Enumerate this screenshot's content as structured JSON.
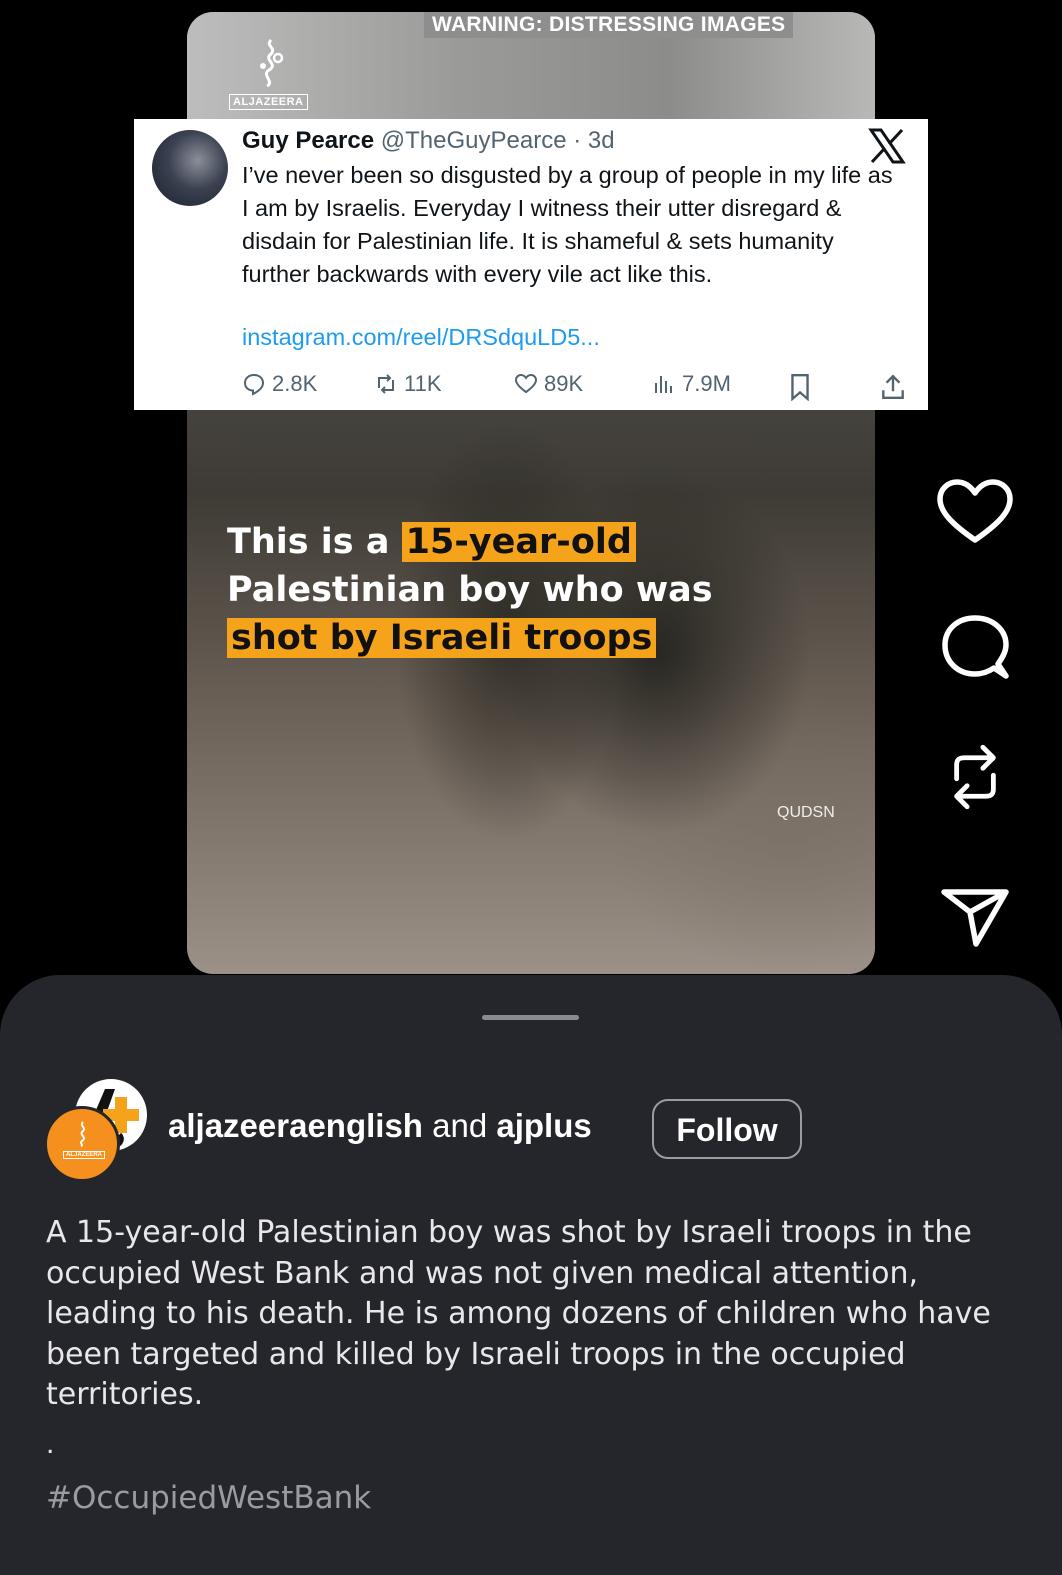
{
  "video": {
    "warning": "WARNING: DISTRESSING IMAGES",
    "logo_label": "ALJAZEERA",
    "caption": {
      "part1": "This is a ",
      "highlight1": "15-year-old",
      "line2": "Palestinian boy who was",
      "highlight2": "shot by Israeli troops"
    },
    "credit": "QUDSN"
  },
  "tweet": {
    "name": "Guy Pearce",
    "handle": "@TheGuyPearce · 3d",
    "text": "I’ve never been so disgusted by a group of people in my life as I am by Israelis. Everyday I witness their utter disregard & disdain for Palestinian life. It is shameful & sets humanity further backwards with every vile act like this.",
    "link": "instagram.com/reel/DRSdquLD5...",
    "stats": {
      "replies": "2.8K",
      "reposts": "11K",
      "likes": "89K",
      "views": "7.9M"
    }
  },
  "sheet": {
    "account1": "aljazeeraenglish",
    "conjunction": " and ",
    "account2": "ajplus",
    "follow_label": "Follow",
    "avatar_label": "ALJAZEERA",
    "description": "A 15-year-old Palestinian boy was shot by Israeli troops in the occupied West Bank and was not given medical attention, leading to his death. He is among dozens of children who have been targeted and killed by Israeli troops in the occupied territories.",
    "separator": ".",
    "hashtag": "#OccupiedWestBank"
  },
  "icons": [
    "heart-icon",
    "comment-icon",
    "repost-icon",
    "share-icon"
  ],
  "colors": {
    "highlight": "#f5a31a",
    "link": "#1d9bf0",
    "sheet_bg": "#25262b",
    "aje_orange": "#f5901e"
  }
}
